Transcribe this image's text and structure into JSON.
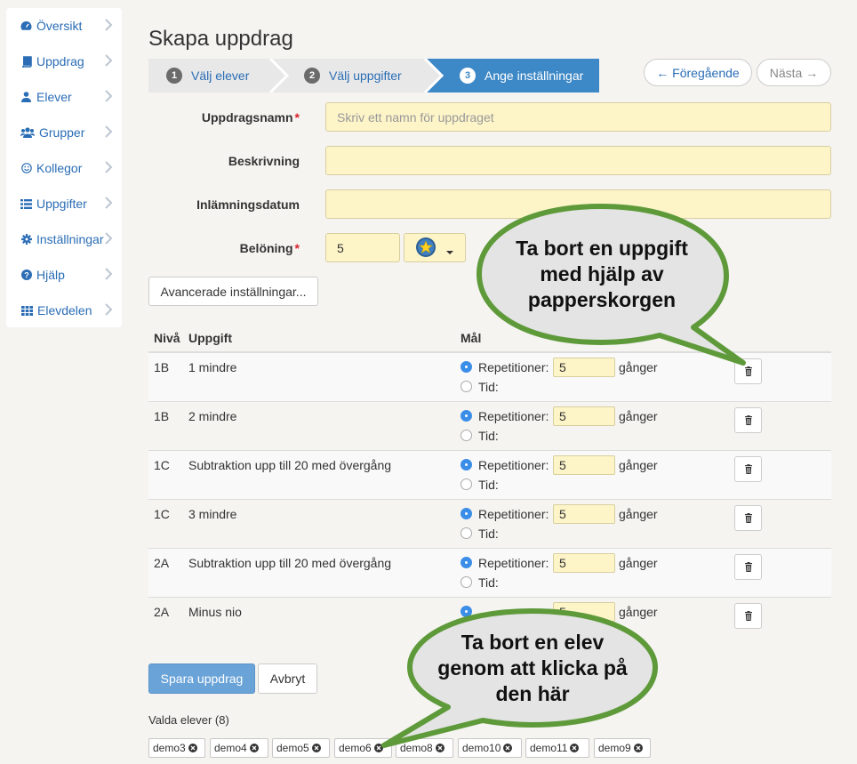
{
  "sidebar": {
    "items": [
      {
        "label": "Översikt",
        "icon": "dashboard-icon"
      },
      {
        "label": "Uppdrag",
        "icon": "book-icon"
      },
      {
        "label": "Elever",
        "icon": "user-icon"
      },
      {
        "label": "Grupper",
        "icon": "users-icon"
      },
      {
        "label": "Kollegor",
        "icon": "smiley-icon"
      },
      {
        "label": "Uppgifter",
        "icon": "list-icon"
      },
      {
        "label": "Inställningar",
        "icon": "gear-icon"
      },
      {
        "label": "Hjälp",
        "icon": "question-icon"
      },
      {
        "label": "Elevdelen",
        "icon": "grid-icon"
      }
    ]
  },
  "page": {
    "title": "Skapa uppdrag"
  },
  "wizard": {
    "steps": [
      {
        "num": "1",
        "label": "Välj elever"
      },
      {
        "num": "2",
        "label": "Välj uppgifter"
      },
      {
        "num": "3",
        "label": "Ange inställningar"
      }
    ]
  },
  "nav": {
    "prev": "← Föregående",
    "next": "Nästa →"
  },
  "form": {
    "name_label": "Uppdragsnamn",
    "name_placeholder": "Skriv ett namn för uppdraget",
    "desc_label": "Beskrivning",
    "date_label": "Inlämningsdatum",
    "reward_label": "Belöning",
    "reward_value": "5",
    "required_mark": "*",
    "advanced_label": "Avancerade inställningar..."
  },
  "table": {
    "headers": {
      "level": "Nivå",
      "task": "Uppgift",
      "goal": "Mål"
    },
    "rep_label": "Repetitioner:",
    "times_label": "gånger",
    "time_label": "Tid:",
    "rows": [
      {
        "level": "1B",
        "task": "1 mindre",
        "reps": "5"
      },
      {
        "level": "1B",
        "task": "2 mindre",
        "reps": "5"
      },
      {
        "level": "1C",
        "task": "Subtraktion upp till 20 med övergång",
        "reps": "5"
      },
      {
        "level": "1C",
        "task": "3 mindre",
        "reps": "5"
      },
      {
        "level": "2A",
        "task": "Subtraktion upp till 20 med övergång",
        "reps": "5"
      },
      {
        "level": "2A",
        "task": "Minus nio",
        "reps": "5"
      }
    ]
  },
  "actions": {
    "save": "Spara uppdrag",
    "cancel": "Avbryt"
  },
  "students": {
    "label": "Valda elever (8)",
    "chips": [
      "demo3",
      "demo4",
      "demo5",
      "demo6",
      "demo8",
      "demo10",
      "demo11",
      "demo9"
    ]
  },
  "bubbles": {
    "trash_line1": "Ta bort en uppgift",
    "trash_line2": "med hjälp av",
    "trash_line3": "papperskorgen",
    "student_line1": "Ta bort en elev",
    "student_line2": "genom att klicka på",
    "student_line3": "den här"
  },
  "colors": {
    "accent": "#3d88c6",
    "link": "#2a6db5",
    "input_bg": "#fdf4c8",
    "bubble_border": "#5e9a3a",
    "bubble_fill": "#e4e4e4"
  }
}
